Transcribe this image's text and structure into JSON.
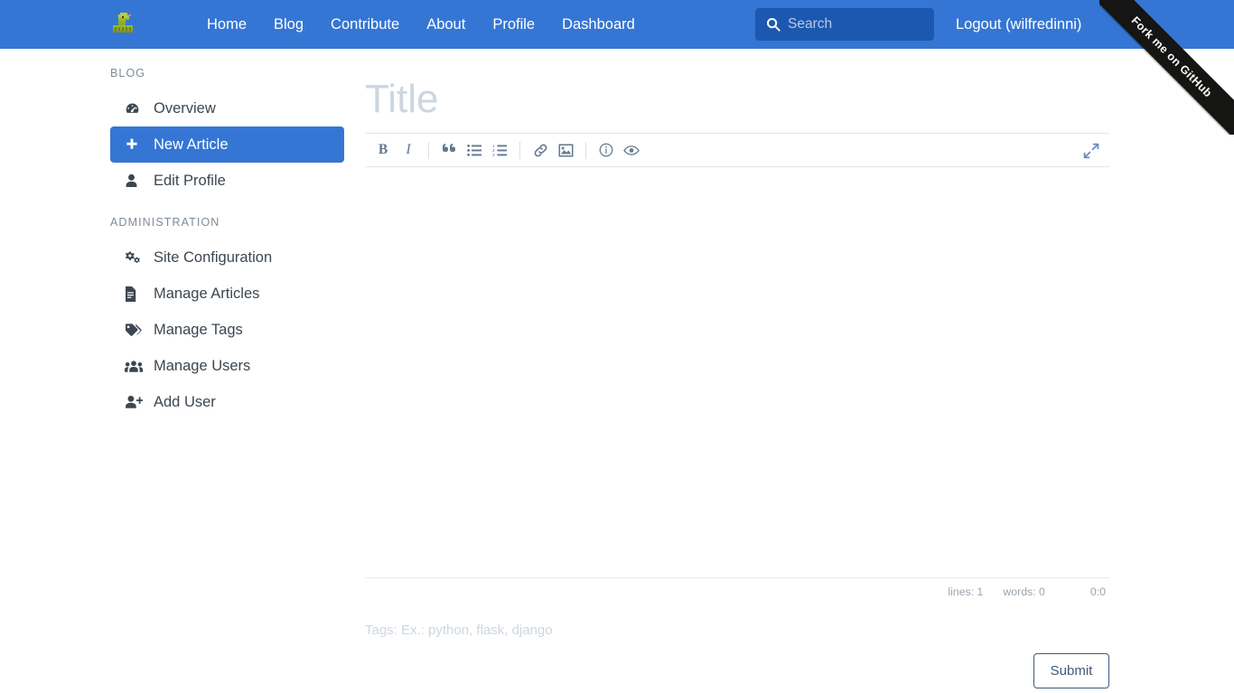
{
  "colors": {
    "nav_blue": "#3576d4",
    "search_blue": "#1c57b0",
    "ribbon_dark": "#151513",
    "text_dark": "#3c4650",
    "muted": "#7f8b96",
    "placeholder": "#ccd6e0",
    "toolbar_icon": "#62778d",
    "submit_border": "#3c5a78",
    "logo_green": "#a3c42b"
  },
  "navbar": {
    "brand_icon": "python-snake-logo",
    "links": [
      {
        "label": "Home",
        "name": "nav-link-home"
      },
      {
        "label": "Blog",
        "name": "nav-link-blog"
      },
      {
        "label": "Contribute",
        "name": "nav-link-contribute"
      },
      {
        "label": "About",
        "name": "nav-link-about"
      },
      {
        "label": "Profile",
        "name": "nav-link-profile"
      },
      {
        "label": "Dashboard",
        "name": "nav-link-dashboard"
      }
    ],
    "search": {
      "placeholder": "Search",
      "value": "",
      "icon": "search-icon"
    },
    "logout_label": "Logout (wilfredinni)"
  },
  "ribbon": {
    "label": "Fork me on GitHub"
  },
  "sidebar": {
    "sections": [
      {
        "heading": "BLOG",
        "items": [
          {
            "label": "Overview",
            "icon": "dashboard-gauge-icon",
            "active": false
          },
          {
            "label": "New Article",
            "icon": "plus-icon",
            "active": true
          },
          {
            "label": "Edit Profile",
            "icon": "user-icon",
            "active": false
          }
        ]
      },
      {
        "heading": "ADMINISTRATION",
        "items": [
          {
            "label": "Site Configuration",
            "icon": "cogs-icon",
            "active": false
          },
          {
            "label": "Manage Articles",
            "icon": "file-icon",
            "active": false
          },
          {
            "label": "Manage Tags",
            "icon": "tags-icon",
            "active": false
          },
          {
            "label": "Manage Users",
            "icon": "users-icon",
            "active": false
          },
          {
            "label": "Add User",
            "icon": "user-plus-icon",
            "active": false
          }
        ]
      }
    ]
  },
  "editor": {
    "title": {
      "placeholder": "Title",
      "value": ""
    },
    "toolbar": [
      {
        "name": "bold-button",
        "glyph": "B",
        "kind": "text"
      },
      {
        "name": "italic-button",
        "glyph": "I",
        "kind": "text"
      },
      {
        "name": "separator-1",
        "kind": "sep"
      },
      {
        "name": "quote-button",
        "glyph": "“",
        "kind": "icon"
      },
      {
        "name": "unordered-list-button",
        "kind": "icon"
      },
      {
        "name": "ordered-list-button",
        "kind": "icon"
      },
      {
        "name": "separator-2",
        "kind": "sep"
      },
      {
        "name": "link-button",
        "kind": "icon"
      },
      {
        "name": "image-button",
        "kind": "icon"
      },
      {
        "name": "separator-3",
        "kind": "sep"
      },
      {
        "name": "info-button",
        "kind": "icon"
      },
      {
        "name": "preview-eye-button",
        "kind": "icon"
      }
    ],
    "fullscreen_icon": "expand-arrows-icon",
    "body": {
      "value": "",
      "placeholder": ""
    },
    "status": {
      "lines": "lines: 1",
      "words": "words: 0",
      "cursor": "0:0"
    },
    "tags": {
      "placeholder": "Tags: Ex.: python, flask, django",
      "value": ""
    },
    "submit_label": "Submit"
  }
}
